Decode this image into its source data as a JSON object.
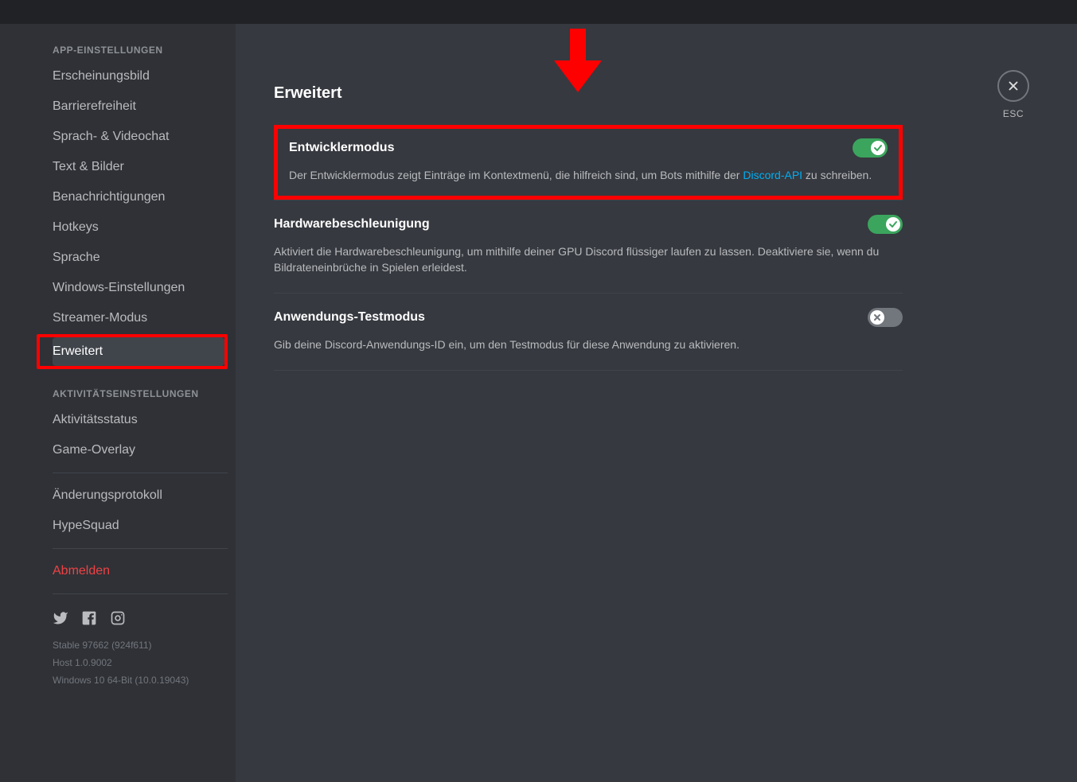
{
  "sidebar": {
    "section_app": "APP-EINSTELLUNGEN",
    "section_activity": "AKTIVITÄTSEINSTELLUNGEN",
    "items_app": [
      "Erscheinungsbild",
      "Barrierefreiheit",
      "Sprach- & Videochat",
      "Text & Bilder",
      "Benachrichtigungen",
      "Hotkeys",
      "Sprache",
      "Windows-Einstellungen",
      "Streamer-Modus",
      "Erweitert"
    ],
    "active_index": 9,
    "items_activity": [
      "Aktivitätsstatus",
      "Game-Overlay"
    ],
    "items_misc": [
      "Änderungsprotokoll",
      "HypeSquad"
    ],
    "logout": "Abmelden",
    "version": [
      "Stable 97662 (924f611)",
      "Host 1.0.9002",
      "Windows 10 64-Bit (10.0.19043)"
    ]
  },
  "page": {
    "title": "Erweitert",
    "settings": [
      {
        "title": "Entwicklermodus",
        "desc_pre": "Der Entwicklermodus zeigt Einträge im Kontextmenü, die hilfreich sind, um Bots mithilfe der ",
        "link": "Discord-API",
        "desc_post": " zu schreiben.",
        "on": true
      },
      {
        "title": "Hardwarebeschleunigung",
        "desc": "Aktiviert die Hardwarebeschleunigung, um mithilfe deiner GPU Discord flüssiger laufen zu lassen. Deaktiviere sie, wenn du Bildrateneinbrüche in Spielen erleidest.",
        "on": true
      },
      {
        "title": "Anwendungs-Testmodus",
        "desc": "Gib deine Discord-Anwendungs-ID ein, um den Testmodus für diese Anwendung zu aktivieren.",
        "on": false
      }
    ]
  },
  "close": {
    "label": "ESC"
  }
}
